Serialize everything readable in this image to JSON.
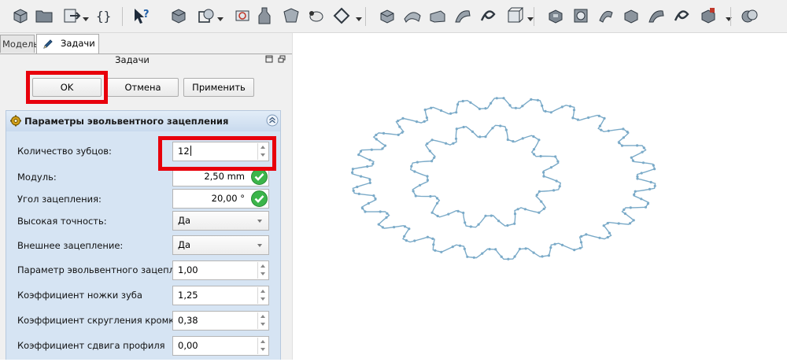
{
  "toolbar": {
    "icons": [
      "part-cube-icon",
      "open-folder-icon",
      "export-arrow-icon",
      "macro-braces-icon",
      "whats-this-icon",
      "part-body-icon",
      "sketch-icon",
      "attach-sketch-icon",
      "bottle-icon",
      "shape-binder-icon",
      "sheep-icon",
      "diamond-datum-icon",
      "pad-icon",
      "revolution-icon",
      "loft-icon",
      "sweep-icon",
      "helix-icon",
      "additive-box-icon",
      "pocket-icon",
      "hole-icon",
      "groove-icon",
      "subtractive-loft-icon",
      "subtractive-sweep-icon",
      "subtractive-helix-icon",
      "subtractive-box-icon",
      "boolean-icon"
    ]
  },
  "tabs": {
    "model": "Модель",
    "tasks": "Задачи"
  },
  "task_panel": {
    "title": "Задачи",
    "ok_label": "OK",
    "cancel_label": "Отмена",
    "apply_label": "Применить"
  },
  "params": {
    "title": "Параметры эвольвентного зацепления",
    "fields": {
      "teeth": {
        "label": "Количество зубцов:",
        "value": "12"
      },
      "module": {
        "label": "Модуль:",
        "value": "2,50 mm"
      },
      "angle": {
        "label": "Угол зацепления:",
        "value": "20,00 °"
      },
      "precision": {
        "label": "Высокая точность:",
        "value": "Да"
      },
      "external": {
        "label": "Внешнее зацепление:",
        "value": "Да"
      },
      "involute": {
        "label": "Параметр эвольвентного зацепления",
        "value": "1,00"
      },
      "dedendum": {
        "label": "Коэффициент ножки зуба",
        "value": "1,25"
      },
      "rounding": {
        "label": "Коэффициент скругления кромки",
        "value": "0,38"
      },
      "shift": {
        "label": "Коэффициент сдвига профиля",
        "value": "0,00"
      }
    }
  },
  "viewport": {
    "gear_color": "#7aaac8",
    "outer_teeth": 26,
    "inner_teeth": 12
  },
  "colors": {
    "highlight": "#e8000b",
    "group_bg": "#d6e4f3",
    "check": "#3bb54a"
  }
}
